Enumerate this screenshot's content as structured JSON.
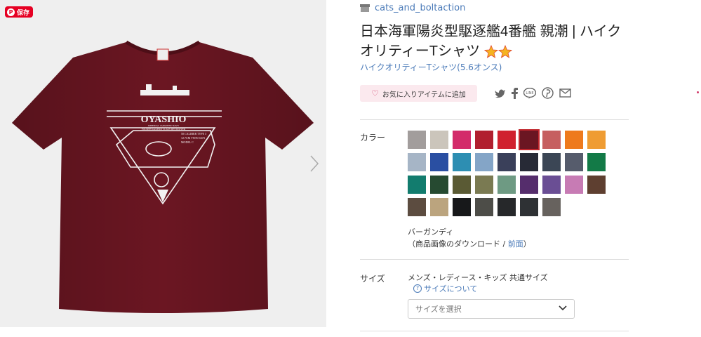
{
  "pin": {
    "label": "保存"
  },
  "product": {
    "shop_name": "cats_and_boltaction",
    "title": "日本海軍陽炎型駆逐艦4番艦 親潮 | ハイクオリティーTシャツ",
    "subtype": "ハイクオリティーTシャツ(5.6オンス)",
    "favorite_label": "お気に入りアイテムに追加"
  },
  "shirt": {
    "color": "#6b1622",
    "print_title": "OYASHIO",
    "print_sub1": "IMPERIAL JAPANESE NAVY",
    "print_sub2": "FOURTH KAGERO CLASS DESTROYER",
    "print_spec1": "50 CALIBER TYPE 3",
    "print_spec2": "12.7CM TWIN GUN",
    "print_spec3": "MODEL C"
  },
  "color_section": {
    "label": "カラー",
    "selected_name": "バーガンディ",
    "download_prefix": "（商品画像のダウンロード / ",
    "download_link": "前面",
    "download_suffix": "）",
    "swatches": [
      "#a29d9c",
      "#cbc5bb",
      "#d32b6a",
      "#b11f2f",
      "#d0212f",
      "#6b1622",
      "#c65f60",
      "#ee7a1d",
      "#ef9c33",
      "#a6b5c6",
      "#2a4fa2",
      "#2d8eb2",
      "#84a5c7",
      "#3a405a",
      "#272a36",
      "#3b4655",
      "#565c6c",
      "#137a47",
      "#127c6e",
      "#264a31",
      "#5a5a34",
      "#7a7a52",
      "#6e9a83",
      "#552d6c",
      "#6a4e94",
      "#c77bb4",
      "#5e3f30",
      "#5c4c40",
      "#bba47e",
      "#17181a",
      "#4d4d48",
      "#26282a",
      "#2e3134",
      "#67625e"
    ],
    "selected_index": 5
  },
  "size_section": {
    "label": "サイズ",
    "note": "メンズ・レディース・キッズ 共通サイズ",
    "about_link": "サイズについて",
    "select_placeholder": "サイズを選択"
  },
  "icons": [
    "pinterest-icon",
    "shop-icon",
    "heart-icon",
    "twitter-icon",
    "facebook-icon",
    "line-icon",
    "pinterest-share-icon",
    "mail-icon",
    "chevron-right-icon",
    "chevron-down-icon",
    "help-icon",
    "star-icon"
  ]
}
